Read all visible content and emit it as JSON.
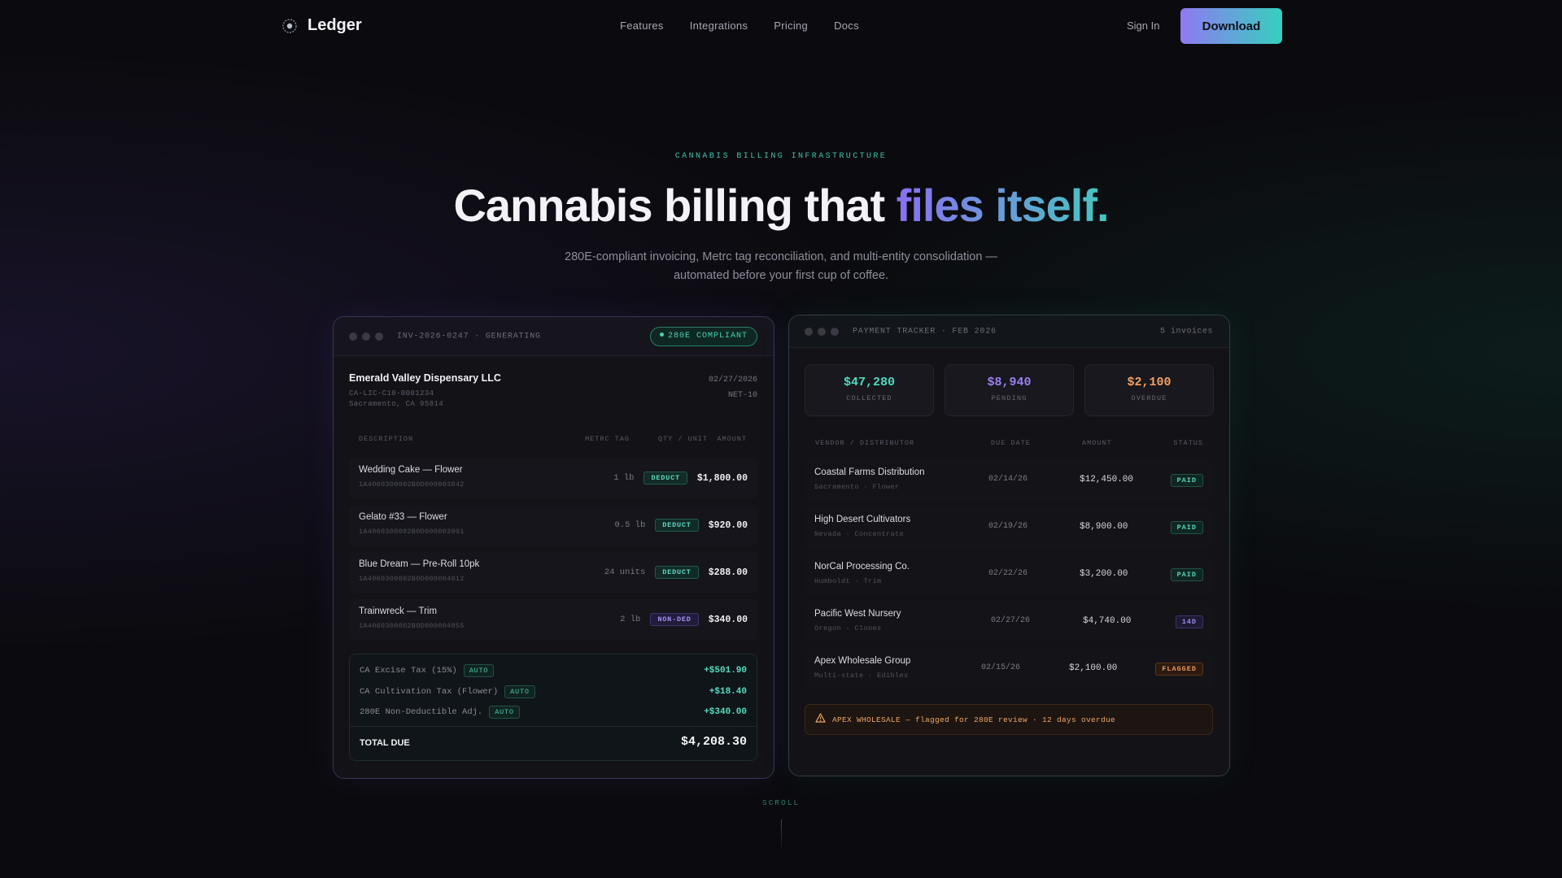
{
  "nav": {
    "brand": "Ledger",
    "links": [
      "Features",
      "Integrations",
      "Pricing",
      "Docs"
    ],
    "signin": "Sign In",
    "download": "Download"
  },
  "hero": {
    "eyebrow": "CANNABIS BILLING INFRASTRUCTURE",
    "headline_plain": "Cannabis billing that ",
    "headline_accent": "files itself.",
    "sub_line1": "280E-compliant invoicing, Metrc tag reconciliation, and multi-entity consolidation —",
    "sub_line2": "automated before your first cup of coffee."
  },
  "invoice": {
    "bar_title": "INV-2026-0247 · GENERATING",
    "compliant_badge": "280E COMPLIANT",
    "customer": "Emerald Valley Dispensary LLC",
    "license": "CA-LIC-C10-0001234",
    "location": "Sacramento, CA 95814",
    "date": "02/27/2026",
    "terms": "NET-10",
    "columns": {
      "description": "DESCRIPTION",
      "metrc_tag": "METRC TAG",
      "qty_unit": "QTY / UNIT",
      "amount": "AMOUNT"
    },
    "items": [
      {
        "name": "Wedding Cake — Flower",
        "tag": "1A4060300002B0D000003842",
        "qty": "1 lb",
        "badge": "DEDUCT",
        "amount": "$1,800.00"
      },
      {
        "name": "Gelato #33 — Flower",
        "tag": "1A4060300002B0D000003901",
        "qty": "0.5 lb",
        "badge": "DEDUCT",
        "amount": "$920.00"
      },
      {
        "name": "Blue Dream — Pre-Roll 10pk",
        "tag": "1A4060300002B0D000004012",
        "qty": "24 units",
        "badge": "DEDUCT",
        "amount": "$288.00"
      },
      {
        "name": "Trainwreck — Trim",
        "tag": "1A4060300002B0D000004055",
        "qty": "2 lb",
        "badge": "NON-DED",
        "amount": "$340.00"
      }
    ],
    "taxes": [
      {
        "label": "CA Excise Tax (15%)",
        "badge": "AUTO",
        "value": "+$501.90"
      },
      {
        "label": "CA Cultivation Tax (Flower)",
        "badge": "AUTO",
        "value": "+$18.40"
      },
      {
        "label": "280E Non-Deductible Adj.",
        "badge": "AUTO",
        "value": "+$340.00"
      }
    ],
    "total_label": "TOTAL DUE",
    "total_value": "$4,208.30"
  },
  "tracker": {
    "bar_title": "PAYMENT TRACKER · FEB 2026",
    "count": "5 invoices",
    "stats": [
      {
        "value": "$47,280",
        "label": "COLLECTED",
        "color": "#4ed9be"
      },
      {
        "value": "$8,940",
        "label": "PENDING",
        "color": "#9b7ff2"
      },
      {
        "value": "$2,100",
        "label": "OVERDUE",
        "color": "#f4a060"
      }
    ],
    "columns": {
      "vendor": "VENDOR / DISTRIBUTOR",
      "due": "DUE DATE",
      "amount": "AMOUNT",
      "status": "STATUS"
    },
    "rows": [
      {
        "name": "Coastal Farms Distribution",
        "meta": "Sacramento · Flower",
        "due": "02/14/26",
        "amount": "$12,450.00",
        "status": "PAID"
      },
      {
        "name": "High Desert Cultivators",
        "meta": "Nevada · Concentrate",
        "due": "02/19/26",
        "amount": "$8,900.00",
        "status": "PAID"
      },
      {
        "name": "NorCal Processing Co.",
        "meta": "Humboldt · Trim",
        "due": "02/22/26",
        "amount": "$3,200.00",
        "status": "PAID"
      },
      {
        "name": "Pacific West Nursery",
        "meta": "Oregon · Clones",
        "due": "02/27/26",
        "amount": "$4,740.00",
        "status": "14D"
      },
      {
        "name": "Apex Wholesale Group",
        "meta": "Multi-state · Edibles",
        "due": "02/15/26",
        "amount": "$2,100.00",
        "status": "FLAGGED"
      }
    ],
    "alert": "APEX WHOLESALE — flagged for 280E review · 12 days overdue"
  },
  "scroll": "SCROLL"
}
